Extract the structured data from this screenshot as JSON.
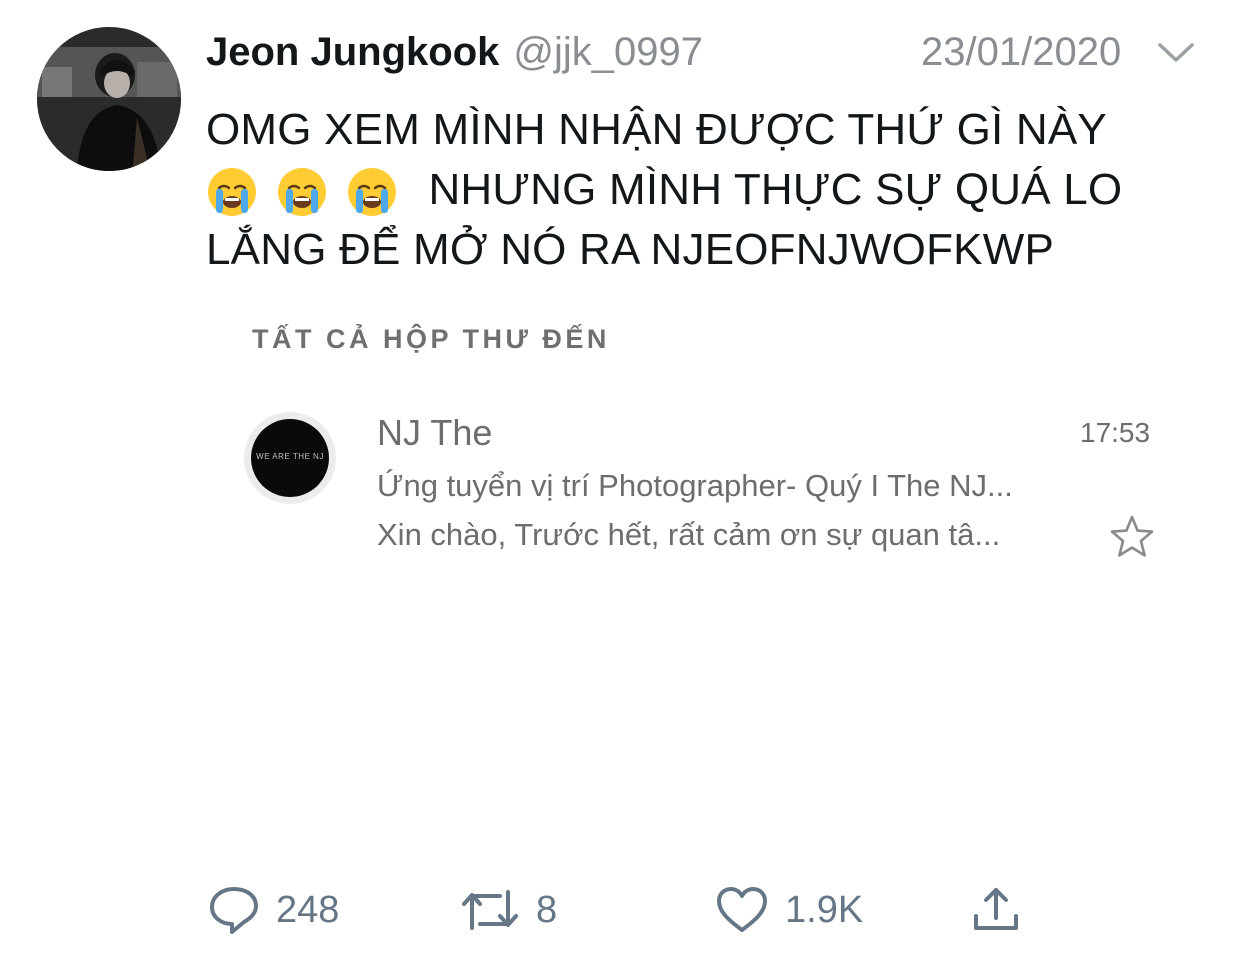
{
  "tweet": {
    "display_name": "Jeon Jungkook",
    "handle": "@jjk_0997",
    "date": "23/01/2020",
    "text_line1": "OMG XEM MÌNH NHẬN ĐƯỢC THỨ GÌ NÀY",
    "text_line2": "NHƯNG MÌNH THỰC SỰ QUÁ LO",
    "text_line3": "LẮNG ĐỂ MỞ NÓ RA NJEOFNJWOFKWP",
    "emojis": [
      "loudly-crying-face",
      "loudly-crying-face",
      "loudly-crying-face"
    ]
  },
  "embedded_mail": {
    "section_title": "TẤT CẢ HỘP THƯ ĐẾN",
    "avatar_text": "WE ARE THE NJ",
    "sender": "NJ The",
    "time": "17:53",
    "subject": "Ứng tuyển vị trí Photographer- Quý I The NJ...",
    "preview": "Xin chào, Trước hết, rất cảm ơn sự quan tâ...",
    "star_icon": "star-outline-icon"
  },
  "actions": {
    "reply_count": "248",
    "retweet_count": "8",
    "like_count": "1.9K",
    "icons": [
      "reply-icon",
      "retweet-icon",
      "like-icon",
      "share-icon"
    ]
  },
  "colors": {
    "primary_text": "#14171a",
    "secondary_text": "#8a8d91",
    "action_gray": "#657786",
    "mail_gray": "#6d6d6d"
  }
}
